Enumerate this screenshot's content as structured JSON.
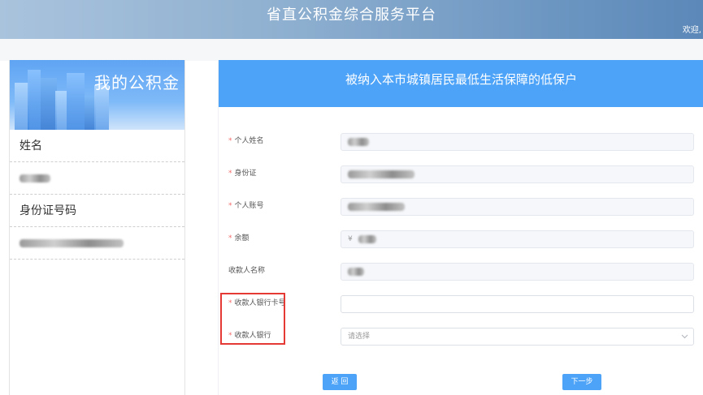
{
  "header": {
    "title": "省直公积金综合服务平台",
    "welcome": "欢迎,"
  },
  "sidebar": {
    "banner_title": "我的公积金",
    "name_label": "姓名",
    "id_label": "身份证号码"
  },
  "form": {
    "title": "被纳入本市城镇居民最低生活保障的低保户",
    "fields": [
      {
        "label": "个人姓名",
        "required": "*"
      },
      {
        "label": "身份证",
        "required": "*"
      },
      {
        "label": "个人账号",
        "required": "*"
      },
      {
        "label": "余额",
        "required": "*",
        "prefix": "¥"
      },
      {
        "label": "收款人名称",
        "required": ""
      },
      {
        "label": "收款人银行卡号",
        "required": "*",
        "value": ""
      },
      {
        "label": "收款人银行",
        "required": "*",
        "placeholder": "请选择"
      }
    ],
    "back_label": "返 回",
    "next_label": "下一步"
  },
  "colors": {
    "accent": "#4da3f7",
    "required": "#f56c6c",
    "highlight": "#e53935"
  },
  "icons": {
    "select_arrow": "chevron-down-icon"
  }
}
